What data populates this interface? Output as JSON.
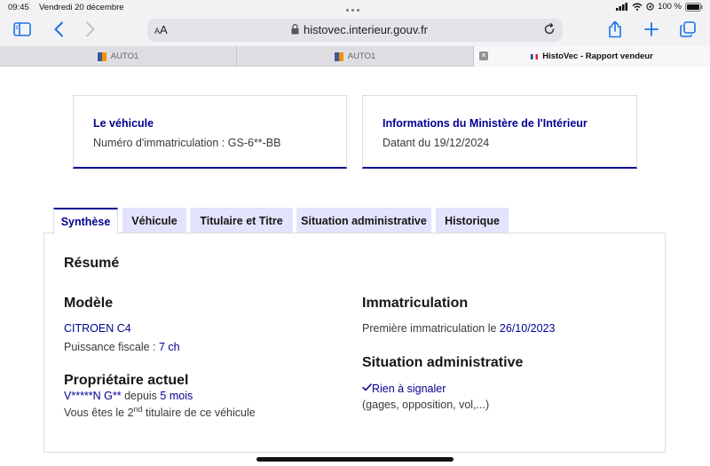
{
  "status": {
    "time": "09:45",
    "date": "Vendredi 20 décembre",
    "battery": "100 %"
  },
  "browser": {
    "aa_small": "A",
    "aa_big": "A",
    "url": "histovec.interieur.gouv.fr",
    "tabs": [
      {
        "label": "AUTO1"
      },
      {
        "label": "AUTO1"
      },
      {
        "label": "HistoVec - Rapport vendeur"
      }
    ]
  },
  "cards": {
    "vehicle": {
      "title": "Le véhicule",
      "text": "Numéro d'immatriculation : GS-6**-BB"
    },
    "ministry": {
      "title": "Informations du Ministère de l'Intérieur",
      "text": "Datant du 19/12/2024"
    }
  },
  "page_tabs": [
    "Synthèse",
    "Véhicule",
    "Titulaire et Titre",
    "Situation administrative",
    "Historique"
  ],
  "summary": {
    "title": "Résumé",
    "model_heading": "Modèle",
    "model_value": "CITROEN C4",
    "fiscal_label": "Puissance fiscale : ",
    "fiscal_value": "7 ch",
    "owner_heading": "Propriétaire actuel",
    "owner_name": "V*****N G**",
    "owner_since_label": " depuis ",
    "owner_since_value": "5 mois",
    "holder_prefix": "Vous êtes le 2",
    "holder_sup": "nd",
    "holder_suffix": " titulaire de ce véhicule",
    "registration_heading": "Immatriculation",
    "first_reg_label": "Première immatriculation le ",
    "first_reg_date": "26/10/2023",
    "admin_heading": "Situation administrative",
    "admin_status": "Rien à signaler",
    "admin_note": "(gages, opposition, vol,...)"
  }
}
